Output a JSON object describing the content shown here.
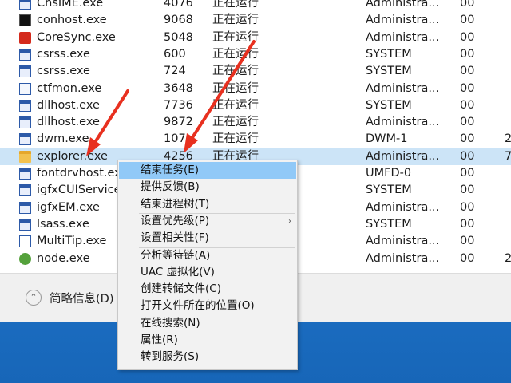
{
  "processes": [
    {
      "name": "ChsIME.exe",
      "pid": "4076",
      "status": "正在运行",
      "user": "Administra...",
      "cpu": "00",
      "mem": "",
      "icon": "window-icon"
    },
    {
      "name": "conhost.exe",
      "pid": "9068",
      "status": "正在运行",
      "user": "Administra...",
      "cpu": "00",
      "mem": "",
      "icon": "console-icon"
    },
    {
      "name": "CoreSync.exe",
      "pid": "5048",
      "status": "正在运行",
      "user": "Administra...",
      "cpu": "00",
      "mem": "",
      "icon": "coresync-icon"
    },
    {
      "name": "csrss.exe",
      "pid": "600",
      "status": "正在运行",
      "user": "SYSTEM",
      "cpu": "00",
      "mem": "",
      "icon": "window-icon"
    },
    {
      "name": "csrss.exe",
      "pid": "724",
      "status": "正在运行",
      "user": "SYSTEM",
      "cpu": "00",
      "mem": "",
      "icon": "window-icon"
    },
    {
      "name": "ctfmon.exe",
      "pid": "3648",
      "status": "正在运行",
      "user": "Administra...",
      "cpu": "00",
      "mem": "",
      "icon": "pen-icon"
    },
    {
      "name": "dllhost.exe",
      "pid": "7736",
      "status": "正在运行",
      "user": "SYSTEM",
      "cpu": "00",
      "mem": "",
      "icon": "window-icon"
    },
    {
      "name": "dllhost.exe",
      "pid": "9872",
      "status": "正在运行",
      "user": "Administra...",
      "cpu": "00",
      "mem": "",
      "icon": "window-icon"
    },
    {
      "name": "dwm.exe",
      "pid": "107",
      "status": "正在运行",
      "user": "DWM-1",
      "cpu": "00",
      "mem": "2",
      "icon": "window-icon"
    },
    {
      "name": "explorer.exe",
      "pid": "4256",
      "status": "正在运行",
      "user": "Administra...",
      "cpu": "00",
      "mem": "7",
      "icon": "folder-icon",
      "selected": true
    },
    {
      "name": "fontdrvhost.ex",
      "pid": "",
      "status": "",
      "user": "UMFD-0",
      "cpu": "00",
      "mem": "",
      "icon": "window-icon"
    },
    {
      "name": "igfxCUIService",
      "pid": "",
      "status": "",
      "user": "SYSTEM",
      "cpu": "00",
      "mem": "",
      "icon": "window-icon"
    },
    {
      "name": "igfxEM.exe",
      "pid": "",
      "status": "",
      "user": "Administra...",
      "cpu": "00",
      "mem": "",
      "icon": "window-icon"
    },
    {
      "name": "lsass.exe",
      "pid": "",
      "status": "",
      "user": "SYSTEM",
      "cpu": "00",
      "mem": "",
      "icon": "window-icon"
    },
    {
      "name": "MultiTip.exe",
      "pid": "",
      "status": "",
      "user": "Administra...",
      "cpu": "00",
      "mem": "",
      "icon": "blank-window-icon"
    },
    {
      "name": "node.exe",
      "pid": "",
      "status": "",
      "user": "Administra...",
      "cpu": "00",
      "mem": "2",
      "icon": "node-icon"
    }
  ],
  "footer": {
    "toggle_glyph": "⌃",
    "label": "简略信息(D)"
  },
  "context_menu": [
    {
      "label": "结束任务(E)",
      "hover": true
    },
    {
      "label": "提供反馈(B)"
    },
    {
      "label": "结束进程树(T)",
      "sep_after": true
    },
    {
      "label": "设置优先级(P)",
      "submenu": true
    },
    {
      "label": "设置相关性(F)",
      "sep_after": true
    },
    {
      "label": "分析等待链(A)"
    },
    {
      "label": "UAC 虚拟化(V)"
    },
    {
      "label": "创建转储文件(C)",
      "sep_after": true
    },
    {
      "label": "打开文件所在的位置(O)"
    },
    {
      "label": "在线搜索(N)"
    },
    {
      "label": "属性(R)"
    },
    {
      "label": "转到服务(S)"
    }
  ],
  "colors": {
    "annotation_arrow": "#e8301f",
    "selection": "#cce4f7",
    "menu_hover": "#91c9f7"
  }
}
